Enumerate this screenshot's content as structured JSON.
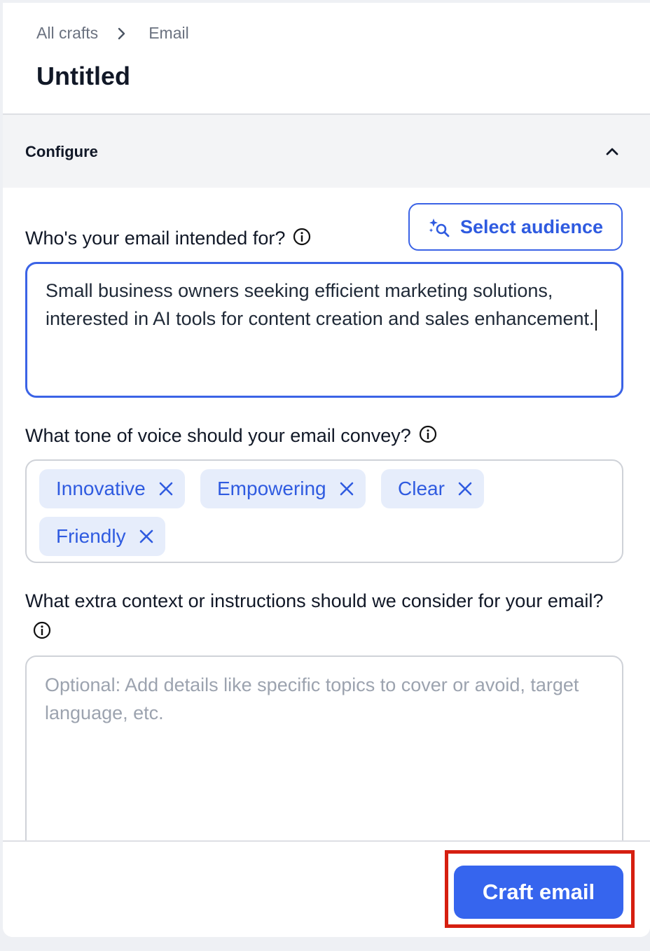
{
  "breadcrumb": {
    "root": "All crafts",
    "current": "Email"
  },
  "page_title": "Untitled",
  "configure": {
    "title": "Configure"
  },
  "audience": {
    "label": "Who's your email intended for?",
    "select_button": "Select audience",
    "value": "Small business owners seeking efficient marketing solutions, interested in AI tools for content creation and sales enhancement."
  },
  "tone": {
    "label": "What tone of voice should your email convey?",
    "chips": [
      "Innovative",
      "Empowering",
      "Clear",
      "Friendly"
    ]
  },
  "context": {
    "label": "What extra context or instructions should we consider for your email?",
    "placeholder": "Optional: Add details like specific topics to cover or avoid, target language, etc."
  },
  "footer": {
    "craft_button": "Craft email"
  },
  "colors": {
    "accent": "#3665ee",
    "chip_bg": "#e6edfb",
    "highlight": "#d61f10"
  }
}
